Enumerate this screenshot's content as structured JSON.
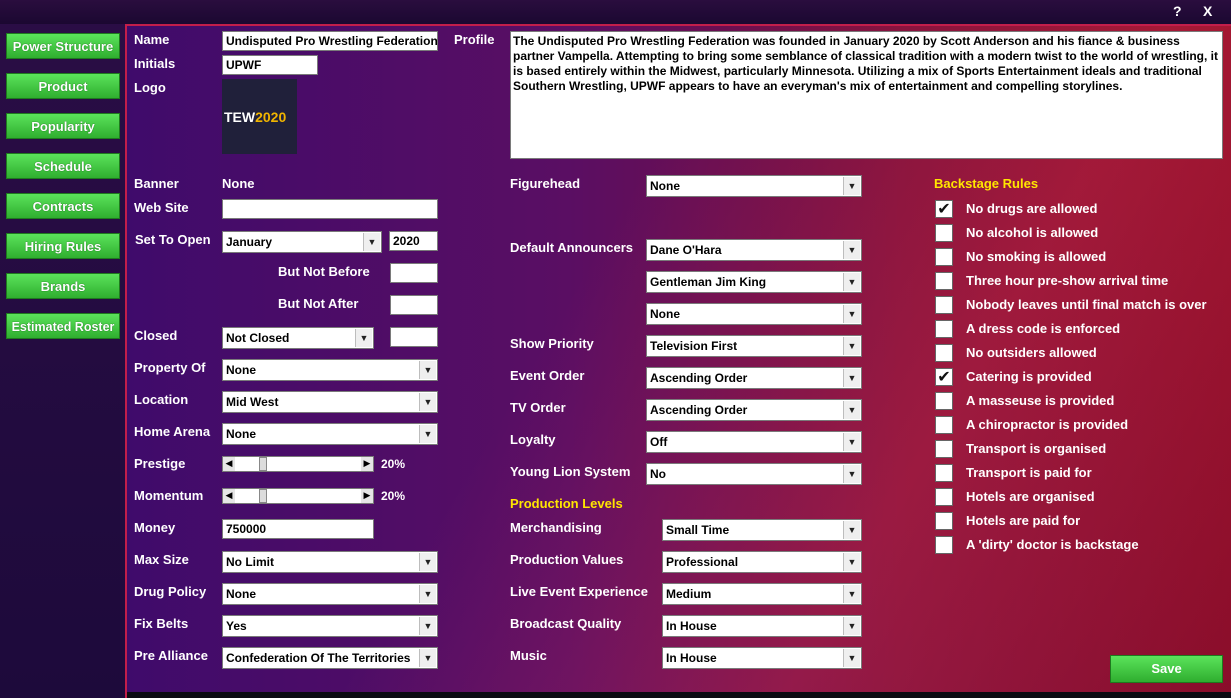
{
  "window": {
    "help": "?",
    "close": "X"
  },
  "nav": [
    "Power Structure",
    "Product",
    "Popularity",
    "Schedule",
    "Contracts",
    "Hiring Rules",
    "Brands",
    "Estimated Roster"
  ],
  "labels": {
    "name": "Name",
    "initials": "Initials",
    "logo": "Logo",
    "profile": "Profile",
    "banner": "Banner",
    "website": "Web Site",
    "set_to_open": "Set To Open",
    "not_before": "But Not Before",
    "not_after": "But Not After",
    "closed": "Closed",
    "property_of": "Property Of",
    "location": "Location",
    "home_arena": "Home Arena",
    "prestige": "Prestige",
    "momentum": "Momentum",
    "money": "Money",
    "max_size": "Max Size",
    "drug_policy": "Drug Policy",
    "fix_belts": "Fix Belts",
    "pre_alliance": "Pre Alliance",
    "figurehead": "Figurehead",
    "default_announcers": "Default Announcers",
    "show_priority": "Show Priority",
    "event_order": "Event Order",
    "tv_order": "TV Order",
    "loyalty": "Loyalty",
    "young_lion": "Young Lion System",
    "production_levels": "Production Levels",
    "merchandising": "Merchandising",
    "production_values": "Production Values",
    "live_event": "Live Event Experience",
    "broadcast_quality": "Broadcast Quality",
    "music": "Music",
    "backstage_rules": "Backstage Rules"
  },
  "values": {
    "name": "Undisputed Pro Wrestling Federation",
    "initials": "UPWF",
    "logo_text_a": "TEW",
    "logo_text_b": "2020",
    "profile": "The Undisputed Pro Wrestling Federation was founded in January 2020 by Scott Anderson and his fiance & business partner Vampella. Attempting to bring some semblance of classical tradition with a modern twist to the world of wrestling, it is based entirely within the Midwest, particularly Minnesota. Utilizing a mix of Sports Entertainment ideals and traditional Southern Wrestling, UPWF appears to have an everyman's mix of entertainment and compelling storylines.",
    "banner": "None",
    "website": "",
    "open_month": "January",
    "open_year": "2020",
    "not_before": "",
    "not_after": "",
    "closed": "Not Closed",
    "closed_extra": "",
    "property_of": "None",
    "location": "Mid West",
    "home_arena": "None",
    "prestige": "20%",
    "prestige_level": 0.2,
    "momentum": "20%",
    "momentum_level": 0.2,
    "money": "750000",
    "max_size": "No Limit",
    "drug_policy": "None",
    "fix_belts": "Yes",
    "pre_alliance": "Confederation Of The Territories",
    "figurehead": "None",
    "announcer1": "Dane O'Hara",
    "announcer2": "Gentleman Jim King",
    "announcer3": "None",
    "show_priority": "Television First",
    "event_order": "Ascending Order",
    "tv_order": "Ascending Order",
    "loyalty": "Off",
    "young_lion": "No",
    "merchandising": "Small Time",
    "production_values": "Professional",
    "live_event": "Medium",
    "broadcast_quality": "In House",
    "music": "In House"
  },
  "rules": [
    {
      "label": "No drugs are allowed",
      "checked": true
    },
    {
      "label": "No alcohol is allowed",
      "checked": false
    },
    {
      "label": "No smoking is allowed",
      "checked": false
    },
    {
      "label": "Three hour pre-show arrival time",
      "checked": false
    },
    {
      "label": "Nobody leaves until final match is over",
      "checked": false
    },
    {
      "label": "A dress code is enforced",
      "checked": false
    },
    {
      "label": "No outsiders allowed",
      "checked": false
    },
    {
      "label": "Catering is provided",
      "checked": true
    },
    {
      "label": "A masseuse is provided",
      "checked": false
    },
    {
      "label": "A chiropractor is provided",
      "checked": false
    },
    {
      "label": "Transport is organised",
      "checked": false
    },
    {
      "label": "Transport is paid for",
      "checked": false
    },
    {
      "label": "Hotels are organised",
      "checked": false
    },
    {
      "label": "Hotels are paid for",
      "checked": false
    },
    {
      "label": "A 'dirty' doctor is backstage",
      "checked": false
    }
  ],
  "save": "Save"
}
